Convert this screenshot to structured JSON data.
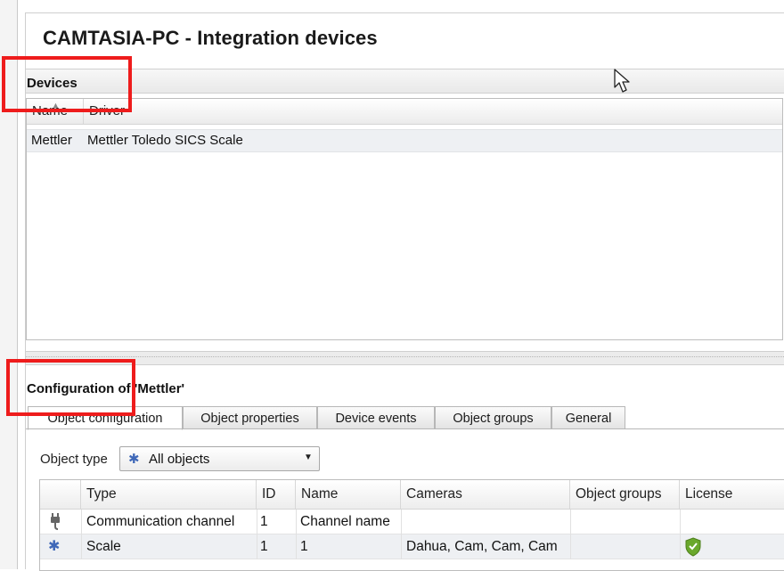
{
  "window": {
    "title": "CAMTASIA-PC - Integration devices"
  },
  "devices": {
    "section_title": "Devices",
    "columns": [
      "Name",
      "Driver"
    ],
    "rows": [
      {
        "name": "Mettler",
        "driver": "Mettler Toledo SICS Scale"
      }
    ]
  },
  "configuration": {
    "section_title": "Configuration of 'Mettler'",
    "tabs": [
      {
        "label": "Object configuration",
        "active": true
      },
      {
        "label": "Object properties",
        "active": false
      },
      {
        "label": "Device events",
        "active": false
      },
      {
        "label": "Object groups",
        "active": false
      },
      {
        "label": "General",
        "active": false
      }
    ],
    "object_type": {
      "label": "Object type",
      "selected": "All objects",
      "icon": "puzzle-icon"
    },
    "objects_grid": {
      "columns": [
        "Type",
        "ID",
        "Name",
        "Cameras",
        "Object groups",
        "License"
      ],
      "rows": [
        {
          "icon": "plug-icon",
          "type": "Communication channel",
          "id": "1",
          "name": "Channel name",
          "cameras": "",
          "object_groups": "",
          "license": ""
        },
        {
          "icon": "puzzle-icon",
          "type": "Scale",
          "id": "1",
          "name": "1",
          "cameras": "Dahua, Cam, Cam, Cam",
          "object_groups": "",
          "license": "shield-check-icon"
        }
      ]
    }
  },
  "colors": {
    "highlight": "#ee1c1c",
    "license_ok": "#6aa82c",
    "object_icon": "#3f68b8"
  }
}
